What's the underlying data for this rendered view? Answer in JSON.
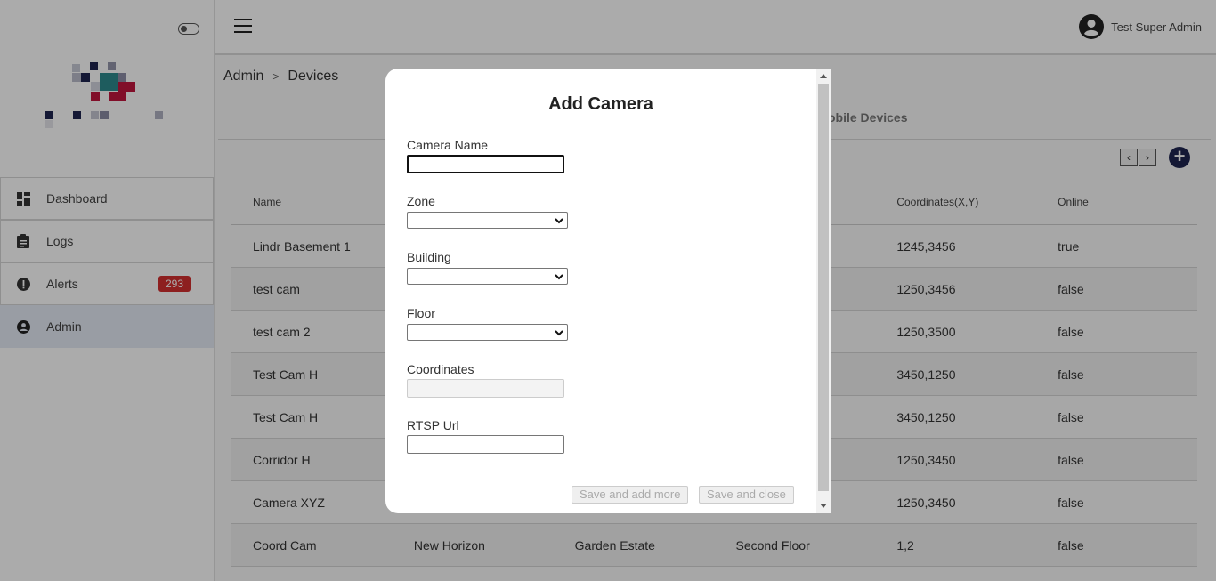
{
  "sidebar": {
    "items": [
      {
        "label": "Dashboard",
        "icon": "dashboard-icon"
      },
      {
        "label": "Logs",
        "icon": "clipboard-icon"
      },
      {
        "label": "Alerts",
        "icon": "alert-icon",
        "badge": "293"
      },
      {
        "label": "Admin",
        "icon": "account-icon",
        "active": true
      }
    ]
  },
  "header": {
    "user_name": "Test Super Admin"
  },
  "breadcrumb": {
    "root": "Admin",
    "separator": ">",
    "current": "Devices"
  },
  "tabs": {
    "mobile_partial": "obile Devices"
  },
  "pager": {
    "prev": "‹",
    "next": "›"
  },
  "table": {
    "headers": [
      "Name",
      "",
      "",
      "",
      "Coordinates(X,Y)",
      "Online"
    ],
    "rows": [
      [
        "Lindr Basement 1",
        "",
        "",
        "",
        "1245,3456",
        "true"
      ],
      [
        "test cam",
        "",
        "",
        "",
        "1250,3456",
        "false"
      ],
      [
        "test cam 2",
        "",
        "",
        "",
        "1250,3500",
        "false"
      ],
      [
        "Test Cam H",
        "",
        "",
        "",
        "3450,1250",
        "false"
      ],
      [
        "Test Cam H",
        "",
        "",
        "",
        "3450,1250",
        "false"
      ],
      [
        "Corridor H",
        "",
        "",
        "",
        "1250,3450",
        "false"
      ],
      [
        "Camera XYZ",
        "",
        "",
        "",
        "1250,3450",
        "false"
      ],
      [
        "Coord Cam",
        "New Horizon",
        "Garden Estate",
        "Second Floor",
        "1,2",
        "false"
      ]
    ]
  },
  "modal": {
    "title": "Add Camera",
    "fields": {
      "camera_name": {
        "label": "Camera Name",
        "value": ""
      },
      "zone": {
        "label": "Zone",
        "value": ""
      },
      "building": {
        "label": "Building",
        "value": ""
      },
      "floor": {
        "label": "Floor",
        "value": ""
      },
      "coordinates": {
        "label": "Coordinates",
        "value": ""
      },
      "rtsp_url": {
        "label": "RTSP Url",
        "value": ""
      }
    },
    "buttons": {
      "save_add_more": "Save and add more",
      "save_close": "Save and close"
    }
  },
  "colors": {
    "accent": "#1f2550",
    "badge": "#d32f2f",
    "active_nav": "#e5ebf5"
  }
}
